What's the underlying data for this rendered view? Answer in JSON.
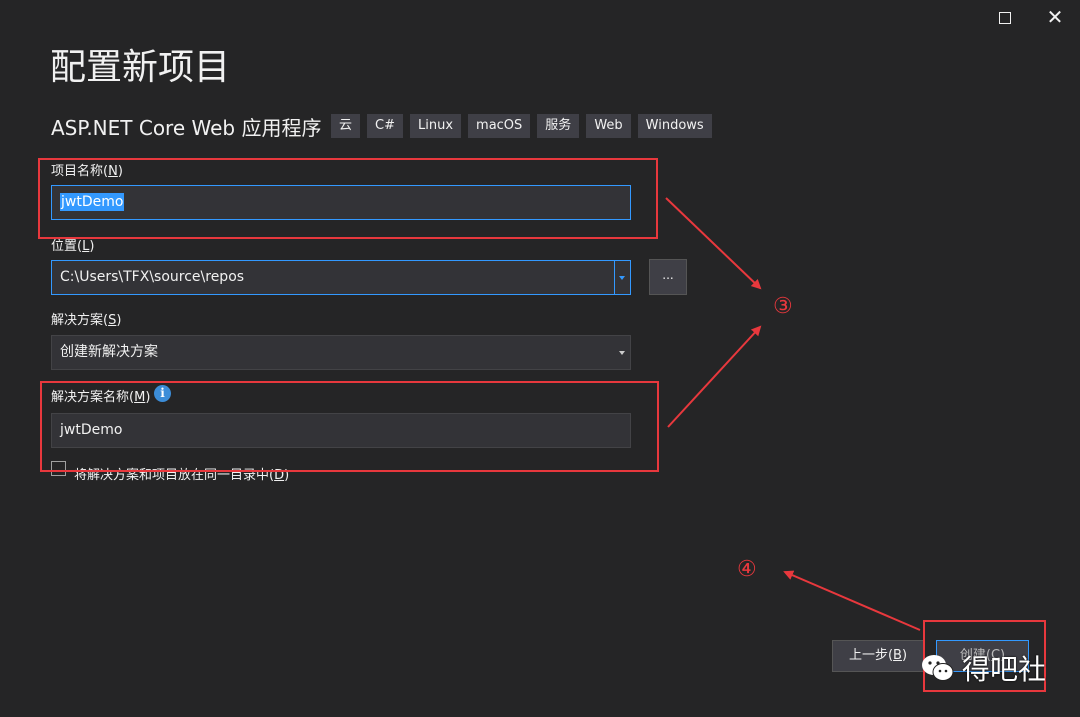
{
  "window": {
    "maximize_icon": "maximize-icon",
    "close_glyph": "✕"
  },
  "title": "配置新项目",
  "template": {
    "name": "ASP.NET Core Web 应用程序",
    "tags": [
      "云",
      "C#",
      "Linux",
      "macOS",
      "服务",
      "Web",
      "Windows"
    ]
  },
  "project_name": {
    "label": "项目名称",
    "shortcut": "N",
    "value": "jwtDemo"
  },
  "location": {
    "label": "位置",
    "shortcut": "L",
    "value": "C:\\Users\\TFX\\source\\repos",
    "browse_label": "..."
  },
  "solution": {
    "label": "解决方案",
    "shortcut": "S",
    "value": "创建新解决方案"
  },
  "solution_name": {
    "label": "解决方案名称",
    "shortcut": "M",
    "value": "jwtDemo",
    "info_glyph": "i"
  },
  "same_dir_checkbox": {
    "label": "将解决方案和项目放在同一目录中",
    "shortcut": "D",
    "checked": false
  },
  "buttons": {
    "back": "上一步",
    "back_shortcut": "B",
    "create": "创建",
    "create_shortcut": "C"
  },
  "annotations": {
    "marker3": "③",
    "marker4": "④",
    "highlight_color": "#e8383d"
  },
  "watermark": {
    "text": "得吧社",
    "icon": "wechat-icon"
  }
}
